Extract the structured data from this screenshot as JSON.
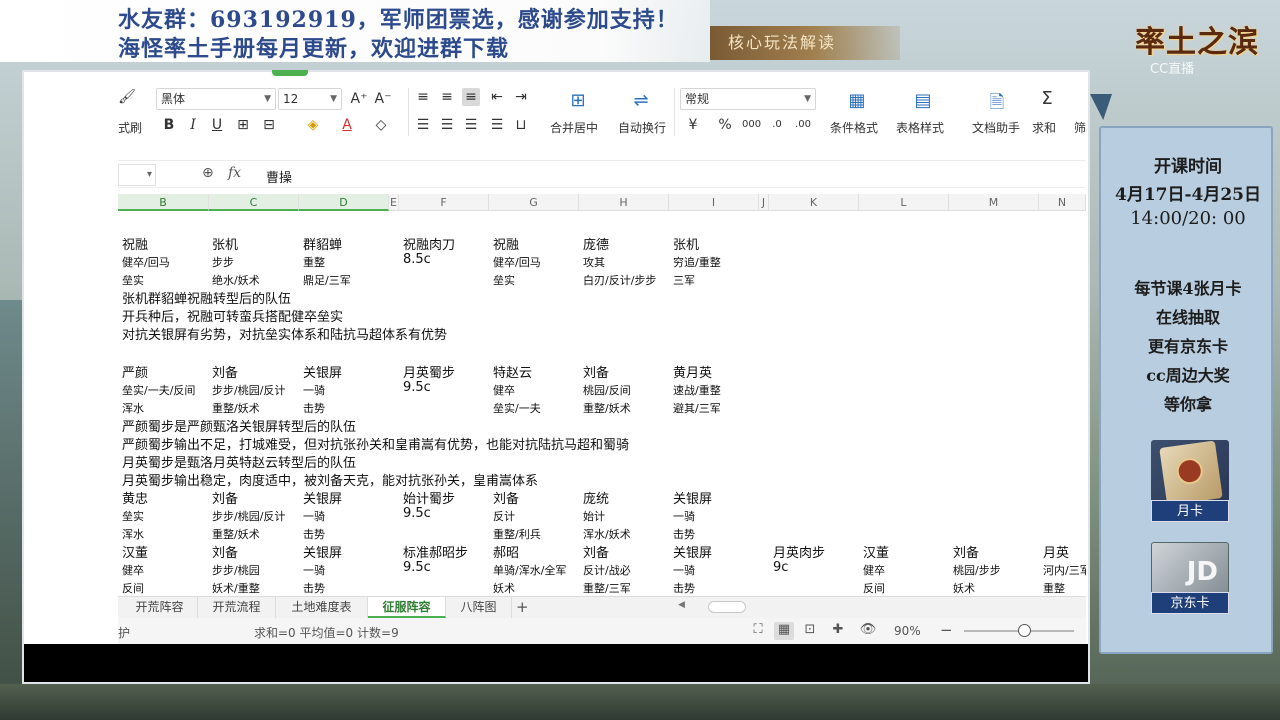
{
  "banner": {
    "line1": "水友群：693192919，军师团票选，感谢参加支持！",
    "line2": "海怪率土手册每月更新，欢迎进群下载",
    "tag": "核心玩法解读"
  },
  "logo": {
    "game_title": "率土之滨",
    "watermark": "CC直播"
  },
  "side_panel": {
    "schedule_title": "开课时间",
    "dates": "4月17日-4月25日",
    "times": "14:00/20: 00",
    "promo_lines": [
      "每节课4张月卡",
      "在线抽取",
      "更有京东卡",
      "cc周边大奖",
      "等你拿"
    ],
    "card1_label": "月卡",
    "card2_label": "京东卡",
    "card2_logo": "JD"
  },
  "ribbon": {
    "font_name": "黑体",
    "font_size": "12",
    "format_painter_label": "式刷",
    "number_format": "常规",
    "merge_label": "合并居中",
    "wrap_label": "自动换行",
    "cond_format_label": "条件格式",
    "table_style_label": "表格样式",
    "doc_helper_label": "文档助手",
    "sum_label": "求和",
    "filter_label": "筛"
  },
  "formula_bar": {
    "fx": "fx",
    "value": "曹操"
  },
  "columns": [
    "B",
    "C",
    "D",
    "E",
    "F",
    "G",
    "H",
    "I",
    "J",
    "K",
    "L",
    "M",
    "N"
  ],
  "sheet": {
    "group1": {
      "names": [
        "祝融",
        "张机",
        "群貂蝉",
        "祝融肉刀",
        "祝融",
        "庞德",
        "张机"
      ],
      "row2": [
        "健卒/回马",
        "步步",
        "重整",
        "8.5c",
        "健卒/回马",
        "攻其",
        "穷追/重整"
      ],
      "row3": [
        "垒实",
        "绝水/妖术",
        "鼎足/三军",
        "",
        "垒实",
        "白刃/反计/步步",
        "三军"
      ],
      "notes": [
        "张机群貂蝉祝融转型后的队伍",
        "开兵种后，祝融可转蛮兵搭配健卒垒实",
        "对抗关银屏有劣势，对抗垒实体系和陆抗马超体系有优势"
      ]
    },
    "group2": {
      "names": [
        "严颜",
        "刘备",
        "关银屏",
        "月英蜀步",
        "特赵云",
        "刘备",
        "黄月英"
      ],
      "row2": [
        "垒实/一夫/反间",
        "步步/桃园/反计",
        "一骑",
        "9.5c",
        "健卒",
        "桃园/反间",
        "速战/重整"
      ],
      "row3": [
        "浑水",
        "重整/妖术",
        "击势",
        "",
        "垒实/一夫",
        "重整/妖术",
        "避其/三军"
      ],
      "notes": [
        "严颜蜀步是严颜甄洛关银屏转型后的队伍",
        "严颜蜀步输出不足，打城难受，但对抗张孙关和皇甫嵩有优势，也能对抗陆抗马超和蜀骑",
        "月英蜀步是甄洛月英特赵云转型后的队伍",
        "月英蜀步输出稳定，肉度适中，被刘备天克，能对抗张孙关，皇甫嵩体系"
      ]
    },
    "group3": {
      "names": [
        "黄忠",
        "刘备",
        "关银屏",
        "始计蜀步",
        "刘备",
        "庞统",
        "关银屏"
      ],
      "row2": [
        "垒实",
        "步步/桃园/反计",
        "一骑",
        "9.5c",
        "反计",
        "始计",
        "一骑"
      ],
      "row3": [
        "浑水",
        "重整/妖术",
        "击势",
        "",
        "重整/利兵",
        "浑水/妖术",
        "击势"
      ]
    },
    "group4": {
      "names": [
        "汉董",
        "刘备",
        "关银屏",
        "标准郝昭步",
        "郝昭",
        "刘备",
        "关银屏",
        "月英肉步",
        "汉董",
        "刘备",
        "月英"
      ],
      "row2": [
        "健卒",
        "步步/桃园",
        "一骑",
        "9.5c",
        "单骑/浑水/全军",
        "反计/战必",
        "一骑",
        "9c",
        "健卒",
        "桃园/步步",
        "河内/三军"
      ],
      "row3": [
        "反间",
        "妖术/重整",
        "击势",
        "",
        "妖术",
        "重整/三军",
        "击势",
        "",
        "反间",
        "妖术",
        "重整"
      ]
    }
  },
  "sheet_tabs": [
    "开荒阵容",
    "开荒流程",
    "土地难度表",
    "征服阵容",
    "八阵图"
  ],
  "active_tab": "征服阵容",
  "status": {
    "left": "护",
    "summary": "求和=0  平均值=0  计数=9",
    "zoom": "90%"
  }
}
